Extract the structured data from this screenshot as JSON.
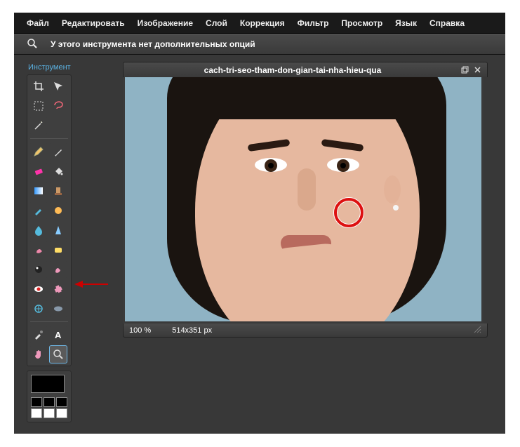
{
  "menubar": {
    "file": "Файл",
    "edit": "Редактировать",
    "image": "Изображение",
    "layer": "Слой",
    "adjust": "Коррекция",
    "filter": "Фильтр",
    "view": "Просмотр",
    "language": "Язык",
    "help": "Справка"
  },
  "optionsbar": {
    "icon": "zoom-icon",
    "text": "У этого инструмента нет дополнительных опций"
  },
  "toolbox": {
    "title": "Инструмент",
    "selected": "zoom"
  },
  "canvas": {
    "title": "cach-tri-seo-tham-don-gian-tai-nha-hieu-qua",
    "zoom": "100  %",
    "size": "514x351 px"
  },
  "colors": {
    "accent": "#5ab0e0",
    "mark": "#d11"
  }
}
